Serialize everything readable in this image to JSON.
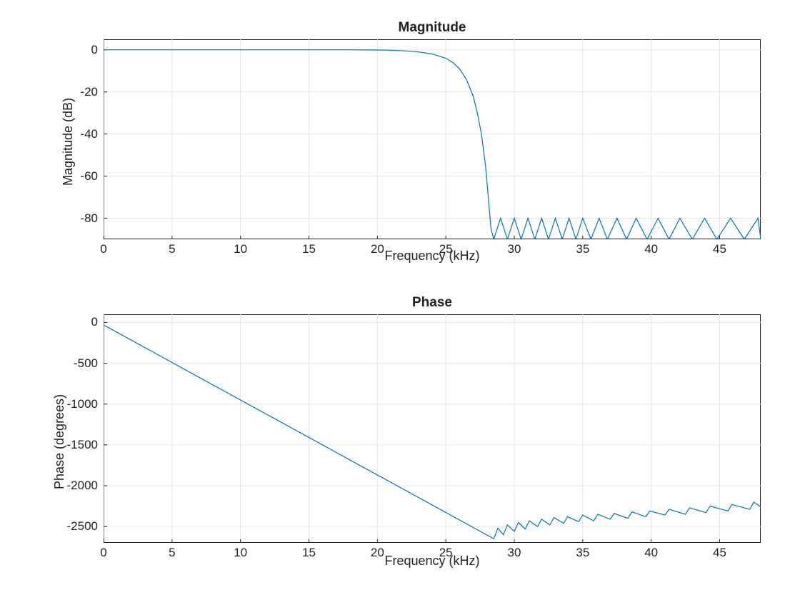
{
  "chart_data": [
    {
      "type": "line",
      "title": "Magnitude",
      "xlabel": "Frequency (kHz)",
      "ylabel": "Magnitude (dB)",
      "xlim": [
        0,
        48
      ],
      "ylim": [
        -90,
        5
      ],
      "xticks": [
        0,
        5,
        10,
        15,
        20,
        25,
        30,
        35,
        40,
        45
      ],
      "yticks": [
        -80,
        -60,
        -40,
        -20,
        0
      ],
      "x": [
        0,
        2,
        4,
        6,
        8,
        10,
        12,
        14,
        16,
        18,
        20,
        21,
        22,
        23,
        24,
        25,
        25.5,
        26,
        26.5,
        27,
        27.3,
        27.6,
        27.9,
        28.1,
        28.3,
        28.5,
        29,
        29.5,
        30,
        30.5,
        31,
        31.5,
        32,
        32.5,
        33,
        33.5,
        34,
        34.5,
        35,
        35.6,
        36.2,
        36.8,
        37.5,
        38.2,
        38.9,
        39.7,
        40.5,
        41.3,
        42.1,
        43,
        43.9,
        44.8,
        45.8,
        46.8,
        47.8,
        48
      ],
      "y": [
        0,
        0,
        0,
        0,
        0,
        0,
        0,
        0,
        0,
        0,
        -0.1,
        -0.2,
        -0.5,
        -1,
        -2,
        -4,
        -6,
        -9,
        -14,
        -22,
        -30,
        -40,
        -55,
        -70,
        -85,
        -90,
        -80,
        -90,
        -80,
        -90,
        -80,
        -90,
        -80,
        -90,
        -80,
        -90,
        -80,
        -90,
        -80,
        -90,
        -80,
        -90,
        -80,
        -90,
        -80,
        -90,
        -80,
        -90,
        -80,
        -90,
        -80,
        -90,
        -80,
        -90,
        -80,
        -90
      ]
    },
    {
      "type": "line",
      "title": "Phase",
      "xlabel": "Frequency (kHz)",
      "ylabel": "Phase (degrees)",
      "xlim": [
        0,
        48
      ],
      "ylim": [
        -2700,
        100
      ],
      "xticks": [
        0,
        5,
        10,
        15,
        20,
        25,
        30,
        35,
        40,
        45
      ],
      "yticks": [
        -2500,
        -2000,
        -1500,
        -1000,
        -500,
        0
      ],
      "x": [
        0,
        28.5,
        28.8,
        29.2,
        29.5,
        30,
        30.3,
        30.8,
        31.1,
        31.7,
        32,
        32.6,
        32.9,
        33.6,
        33.9,
        34.7,
        35,
        35.8,
        36.1,
        37,
        37.3,
        38.3,
        38.6,
        39.6,
        39.9,
        41,
        41.3,
        42.5,
        42.8,
        44,
        44.3,
        45.6,
        45.9,
        47.2,
        47.5,
        48
      ],
      "y": [
        -30,
        -2650,
        -2520,
        -2600,
        -2480,
        -2560,
        -2450,
        -2530,
        -2430,
        -2500,
        -2410,
        -2480,
        -2390,
        -2460,
        -2380,
        -2440,
        -2360,
        -2430,
        -2350,
        -2410,
        -2340,
        -2400,
        -2320,
        -2380,
        -2310,
        -2360,
        -2290,
        -2350,
        -2270,
        -2330,
        -2250,
        -2310,
        -2230,
        -2290,
        -2200,
        -2260
      ]
    }
  ]
}
